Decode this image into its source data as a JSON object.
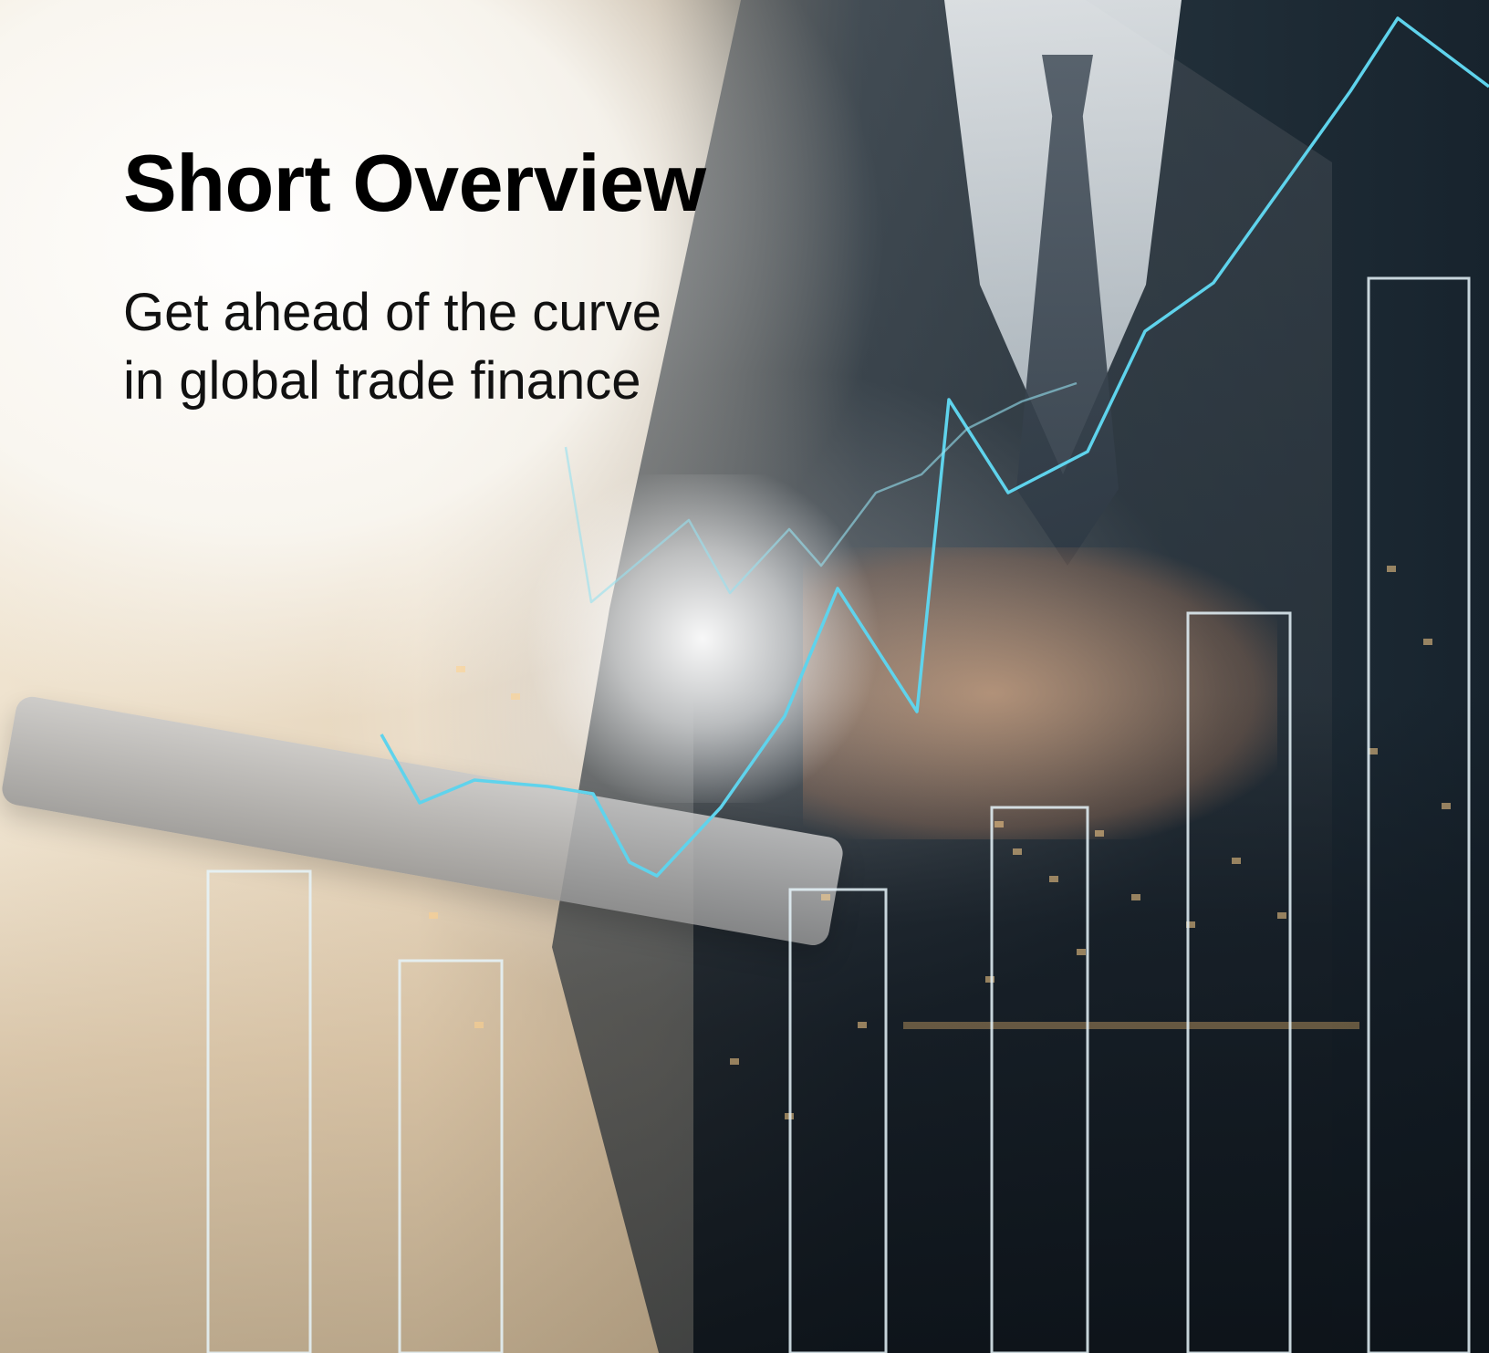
{
  "cover": {
    "title": "Short Overview",
    "subtitle_line_1": "Get ahead of the curve",
    "subtitle_line_2": "in global trade finance"
  },
  "colors": {
    "chart_overlay": "#5fd3ec",
    "title": "#000000"
  }
}
